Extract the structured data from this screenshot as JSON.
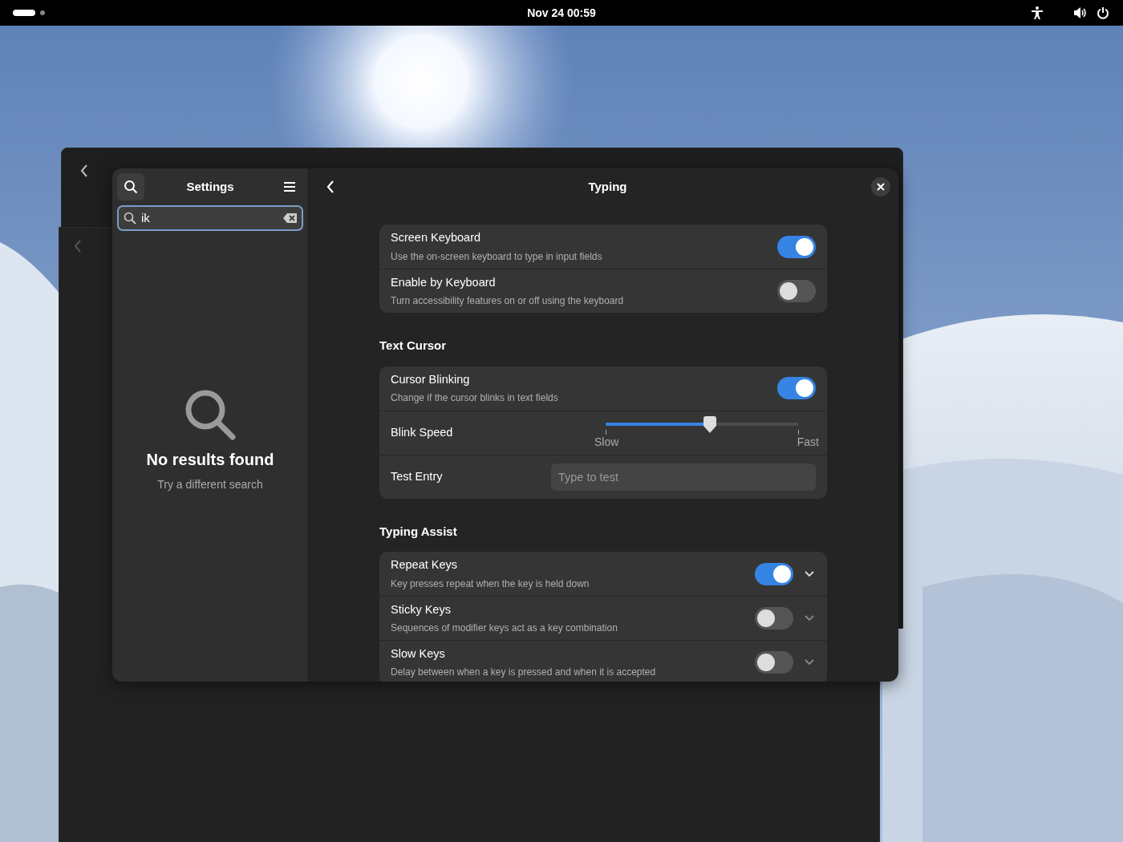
{
  "top_bar": {
    "clock": "Nov 24  00:59"
  },
  "sidebar": {
    "title": "Settings",
    "search": {
      "value": "ik"
    },
    "empty_state": {
      "title": "No results found",
      "subtitle": "Try a different search"
    }
  },
  "page": {
    "title": "Typing",
    "groups": [
      {
        "rows": [
          {
            "kind": "switch",
            "title": "Screen Keyboard",
            "subtitle": "Use the on-screen keyboard to type in input fields",
            "on": true
          },
          {
            "kind": "switch",
            "title": "Enable by Keyboard",
            "subtitle": "Turn accessibility features on or off using the keyboard",
            "on": false
          }
        ]
      },
      {
        "heading": "Text Cursor",
        "rows": [
          {
            "kind": "switch",
            "title": "Cursor Blinking",
            "subtitle": "Change if the cursor blinks in text fields",
            "on": true
          },
          {
            "kind": "slider",
            "title": "Blink Speed",
            "level": 0.54,
            "min_label": "Slow",
            "max_label": "Fast"
          },
          {
            "kind": "entry",
            "title": "Test Entry",
            "placeholder": "Type to test"
          }
        ]
      },
      {
        "heading": "Typing Assist",
        "rows": [
          {
            "kind": "expander",
            "title": "Repeat Keys",
            "subtitle": "Key presses repeat when the key is held down",
            "on": true
          },
          {
            "kind": "expander",
            "title": "Sticky Keys",
            "subtitle": "Sequences of modifier keys act as a key combination",
            "on": false
          },
          {
            "kind": "expander",
            "title": "Slow Keys",
            "subtitle": "Delay between when a key is pressed and when it is accepted",
            "on": false
          }
        ]
      }
    ]
  }
}
